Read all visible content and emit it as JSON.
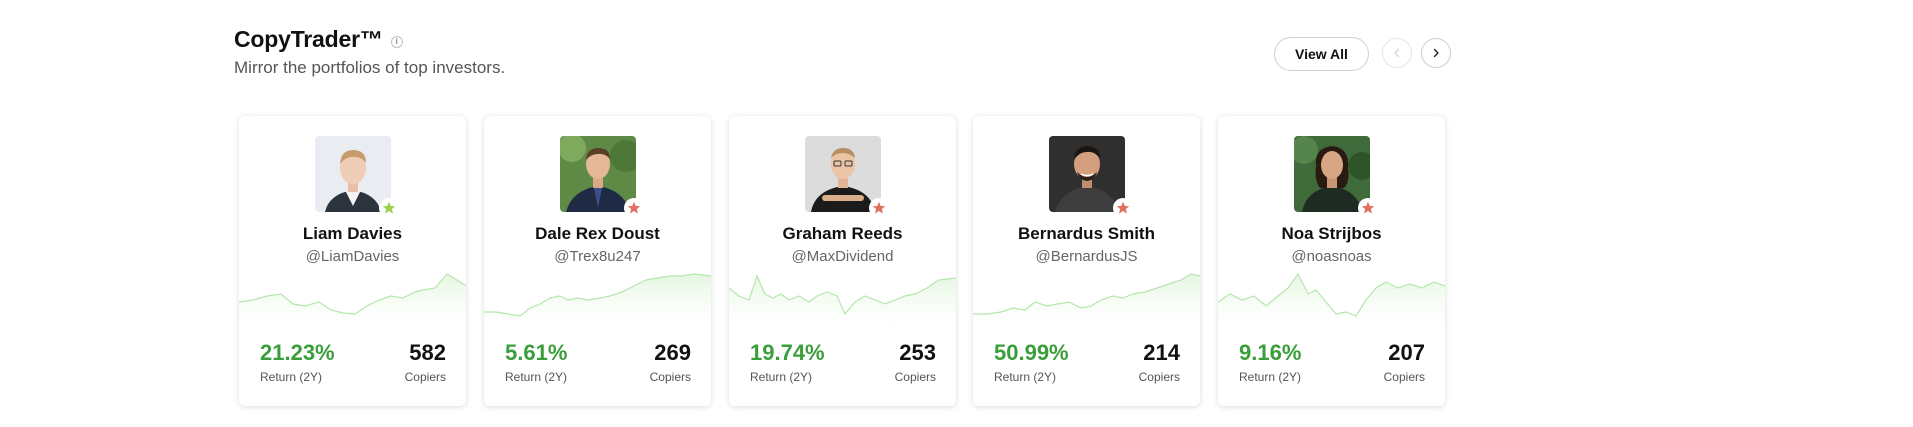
{
  "header": {
    "title": "CopyTrader™",
    "info_icon": "info-icon",
    "subtitle": "Mirror the portfolios of top investors.",
    "view_all_label": "View All"
  },
  "colors": {
    "return_green": "#3a9e3a",
    "star_green": "#9bd14d",
    "star_red": "#e0705f",
    "spark_line": "#b5e6ad"
  },
  "cards": [
    {
      "name": "Liam Davies",
      "handle": "@LiamDavies",
      "return_value": "21.23%",
      "return_label": "Return (2Y)",
      "copiers_value": "582",
      "copiers_label": "Copiers",
      "star_color": "#9bd14d"
    },
    {
      "name": "Dale Rex Doust",
      "handle": "@Trex8u247",
      "return_value": "5.61%",
      "return_label": "Return (2Y)",
      "copiers_value": "269",
      "copiers_label": "Copiers",
      "star_color": "#e0705f"
    },
    {
      "name": "Graham Reeds",
      "handle": "@MaxDividend",
      "return_value": "19.74%",
      "return_label": "Return (2Y)",
      "copiers_value": "253",
      "copiers_label": "Copiers",
      "star_color": "#e0705f"
    },
    {
      "name": "Bernardus Smith",
      "handle": "@BernardusJS",
      "return_value": "50.99%",
      "return_label": "Return (2Y)",
      "copiers_value": "214",
      "copiers_label": "Copiers",
      "star_color": "#e0705f"
    },
    {
      "name": "Noa Strijbos",
      "handle": "@noasnoas",
      "return_value": "9.16%",
      "return_label": "Return (2Y)",
      "copiers_value": "207",
      "copiers_label": "Copiers",
      "star_color": "#e0705f"
    }
  ]
}
